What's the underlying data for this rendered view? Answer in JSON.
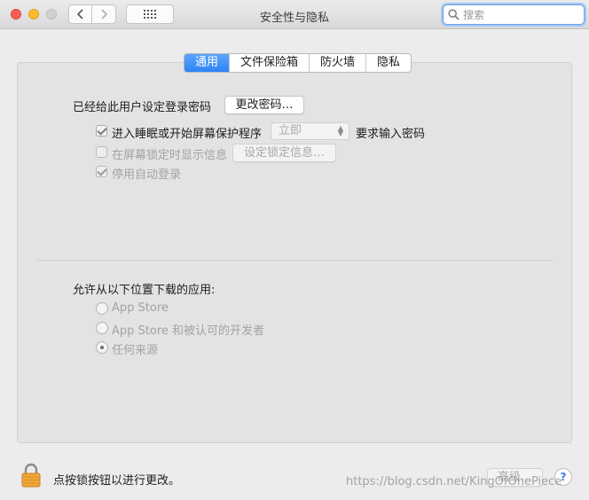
{
  "window": {
    "title": "安全性与隐私"
  },
  "search": {
    "placeholder": "搜索"
  },
  "tabs": [
    {
      "label": "通用",
      "active": true
    },
    {
      "label": "文件保险箱",
      "active": false
    },
    {
      "label": "防火墙",
      "active": false
    },
    {
      "label": "隐私",
      "active": false
    }
  ],
  "general": {
    "password_label": "已经给此用户设定登录密码",
    "change_password_button": "更改密码…",
    "sleep_checkbox_label": "进入睡眠或开始屏幕保护程序",
    "sleep_checkbox_checked": true,
    "sleep_delay_value": "立即",
    "sleep_suffix": "要求输入密码",
    "lock_message_label": "在屏幕锁定时显示信息",
    "lock_message_checked": false,
    "set_lock_message_button": "设定锁定信息…",
    "disable_autologin_label": "停用自动登录",
    "disable_autologin_checked": true
  },
  "downloads": {
    "heading": "允许从以下位置下载的应用:",
    "options": [
      {
        "label": "App Store",
        "selected": false
      },
      {
        "label": "App Store 和被认可的开发者",
        "selected": false
      },
      {
        "label": "任何来源",
        "selected": true
      }
    ]
  },
  "footer": {
    "lock_text": "点按锁按钮以进行更改。",
    "advanced_button": "高级…",
    "help_label": "?"
  },
  "watermark": "https://blog.csdn.net/KingOfOnePiece",
  "colors": {
    "accent": "#2e83f5",
    "lock": "#f0a73a"
  }
}
